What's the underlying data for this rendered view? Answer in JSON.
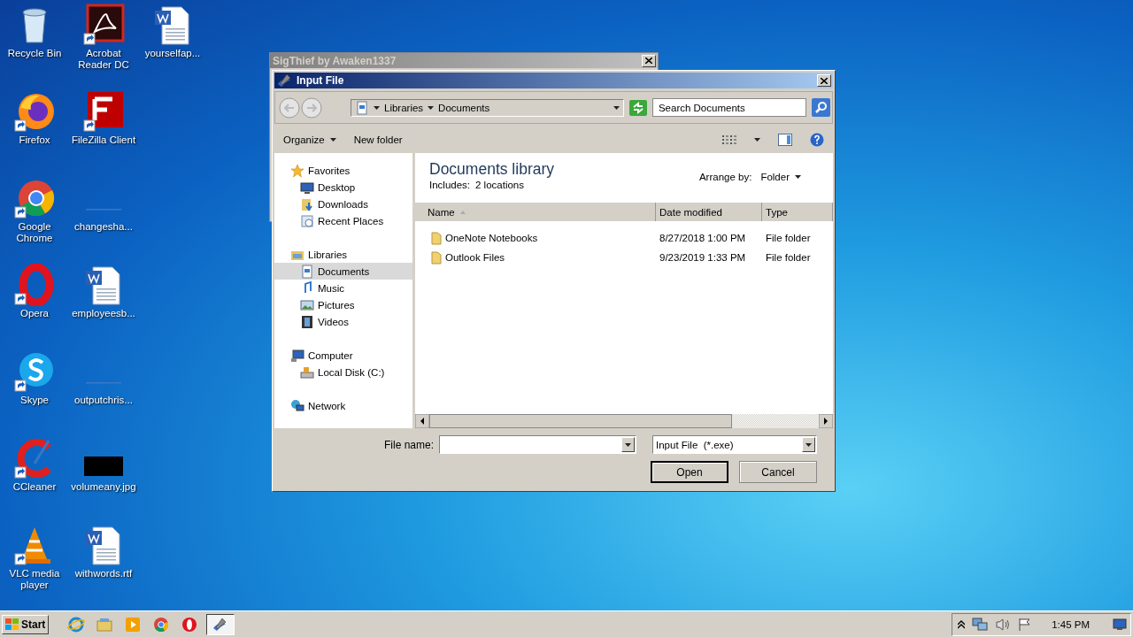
{
  "desktop_icons": [
    {
      "label": "Recycle Bin",
      "kind": "recycle",
      "shortcut": false
    },
    {
      "label": "Firefox",
      "kind": "firefox",
      "shortcut": true
    },
    {
      "label": "Google Chrome",
      "kind": "chrome",
      "shortcut": true
    },
    {
      "label": "Opera",
      "kind": "opera",
      "shortcut": true
    },
    {
      "label": "Skype",
      "kind": "skype",
      "shortcut": true
    },
    {
      "label": "CCleaner",
      "kind": "ccleaner",
      "shortcut": true
    },
    {
      "label": "VLC media player",
      "kind": "vlc",
      "shortcut": true
    },
    {
      "label": "Acrobat Reader DC",
      "kind": "acrobat",
      "shortcut": true
    },
    {
      "label": "FileZilla Client",
      "kind": "filezilla",
      "shortcut": true
    },
    {
      "label": "changesha...",
      "kind": "blank",
      "shortcut": false
    },
    {
      "label": "employeesb...",
      "kind": "word",
      "shortcut": false
    },
    {
      "label": "outputchris...",
      "kind": "blank",
      "shortcut": false
    },
    {
      "label": "volumeany.jpg",
      "kind": "image",
      "shortcut": false
    },
    {
      "label": "withwords.rtf",
      "kind": "word",
      "shortcut": false
    },
    {
      "label": "yourselfap...",
      "kind": "word",
      "shortcut": false
    }
  ],
  "back_window": {
    "title": "SigThief by Awaken1337",
    "active": false
  },
  "dialog": {
    "title": "Input File",
    "active": true,
    "breadcrumb": [
      "Libraries",
      "Documents"
    ],
    "search": {
      "placeholder": "Search Documents"
    },
    "toolbar": [
      "Organize",
      "New folder"
    ],
    "navigation": [
      {
        "label": "Favorites",
        "kind": "star",
        "selected": false,
        "children": [
          {
            "label": "Desktop",
            "kind": "desktop",
            "selected": false
          },
          {
            "label": "Downloads",
            "kind": "download",
            "selected": false
          },
          {
            "label": "Recent Places",
            "kind": "recent",
            "selected": false
          }
        ]
      },
      {
        "label": "Libraries",
        "kind": "library",
        "selected": false,
        "children": [
          {
            "label": "Documents",
            "kind": "document",
            "selected": true
          },
          {
            "label": "Music",
            "kind": "music",
            "selected": false
          },
          {
            "label": "Pictures",
            "kind": "pictures",
            "selected": false
          },
          {
            "label": "Videos",
            "kind": "videos",
            "selected": false
          }
        ]
      },
      {
        "label": "Computer",
        "kind": "computer",
        "selected": false,
        "children": [
          {
            "label": "Local Disk (C:)",
            "kind": "disk",
            "selected": false
          }
        ]
      },
      {
        "label": "Network",
        "kind": "network",
        "selected": false
      }
    ],
    "library_title": "Documents library",
    "includes_label": "Includes:",
    "includes_value": "2 locations",
    "arrange_label": "Arrange by:",
    "arrange_value": "Folder",
    "columns": [
      {
        "label": "Name",
        "sorted": true
      },
      {
        "label": "Date modified",
        "sorted": false
      },
      {
        "label": "Type",
        "sorted": false
      }
    ],
    "files": [
      {
        "name": "OneNote Notebooks",
        "date": "8/27/2018 1:00 PM",
        "type": "File folder"
      },
      {
        "name": "Outlook Files",
        "date": "9/23/2019 1:33 PM",
        "type": "File folder"
      }
    ],
    "file_name_label": "File name:",
    "file_type": "Input File  (*.exe)",
    "buttons": [
      "Open",
      "Cancel"
    ]
  },
  "taskbar": {
    "start": "Start",
    "items": [
      {
        "kind": "ie",
        "selected": false
      },
      {
        "kind": "explorer",
        "selected": false
      },
      {
        "kind": "media",
        "selected": false
      },
      {
        "kind": "chrome",
        "selected": false
      },
      {
        "kind": "opera",
        "selected": false
      },
      {
        "kind": "app",
        "selected": true
      }
    ],
    "clock": "1:45 PM"
  }
}
